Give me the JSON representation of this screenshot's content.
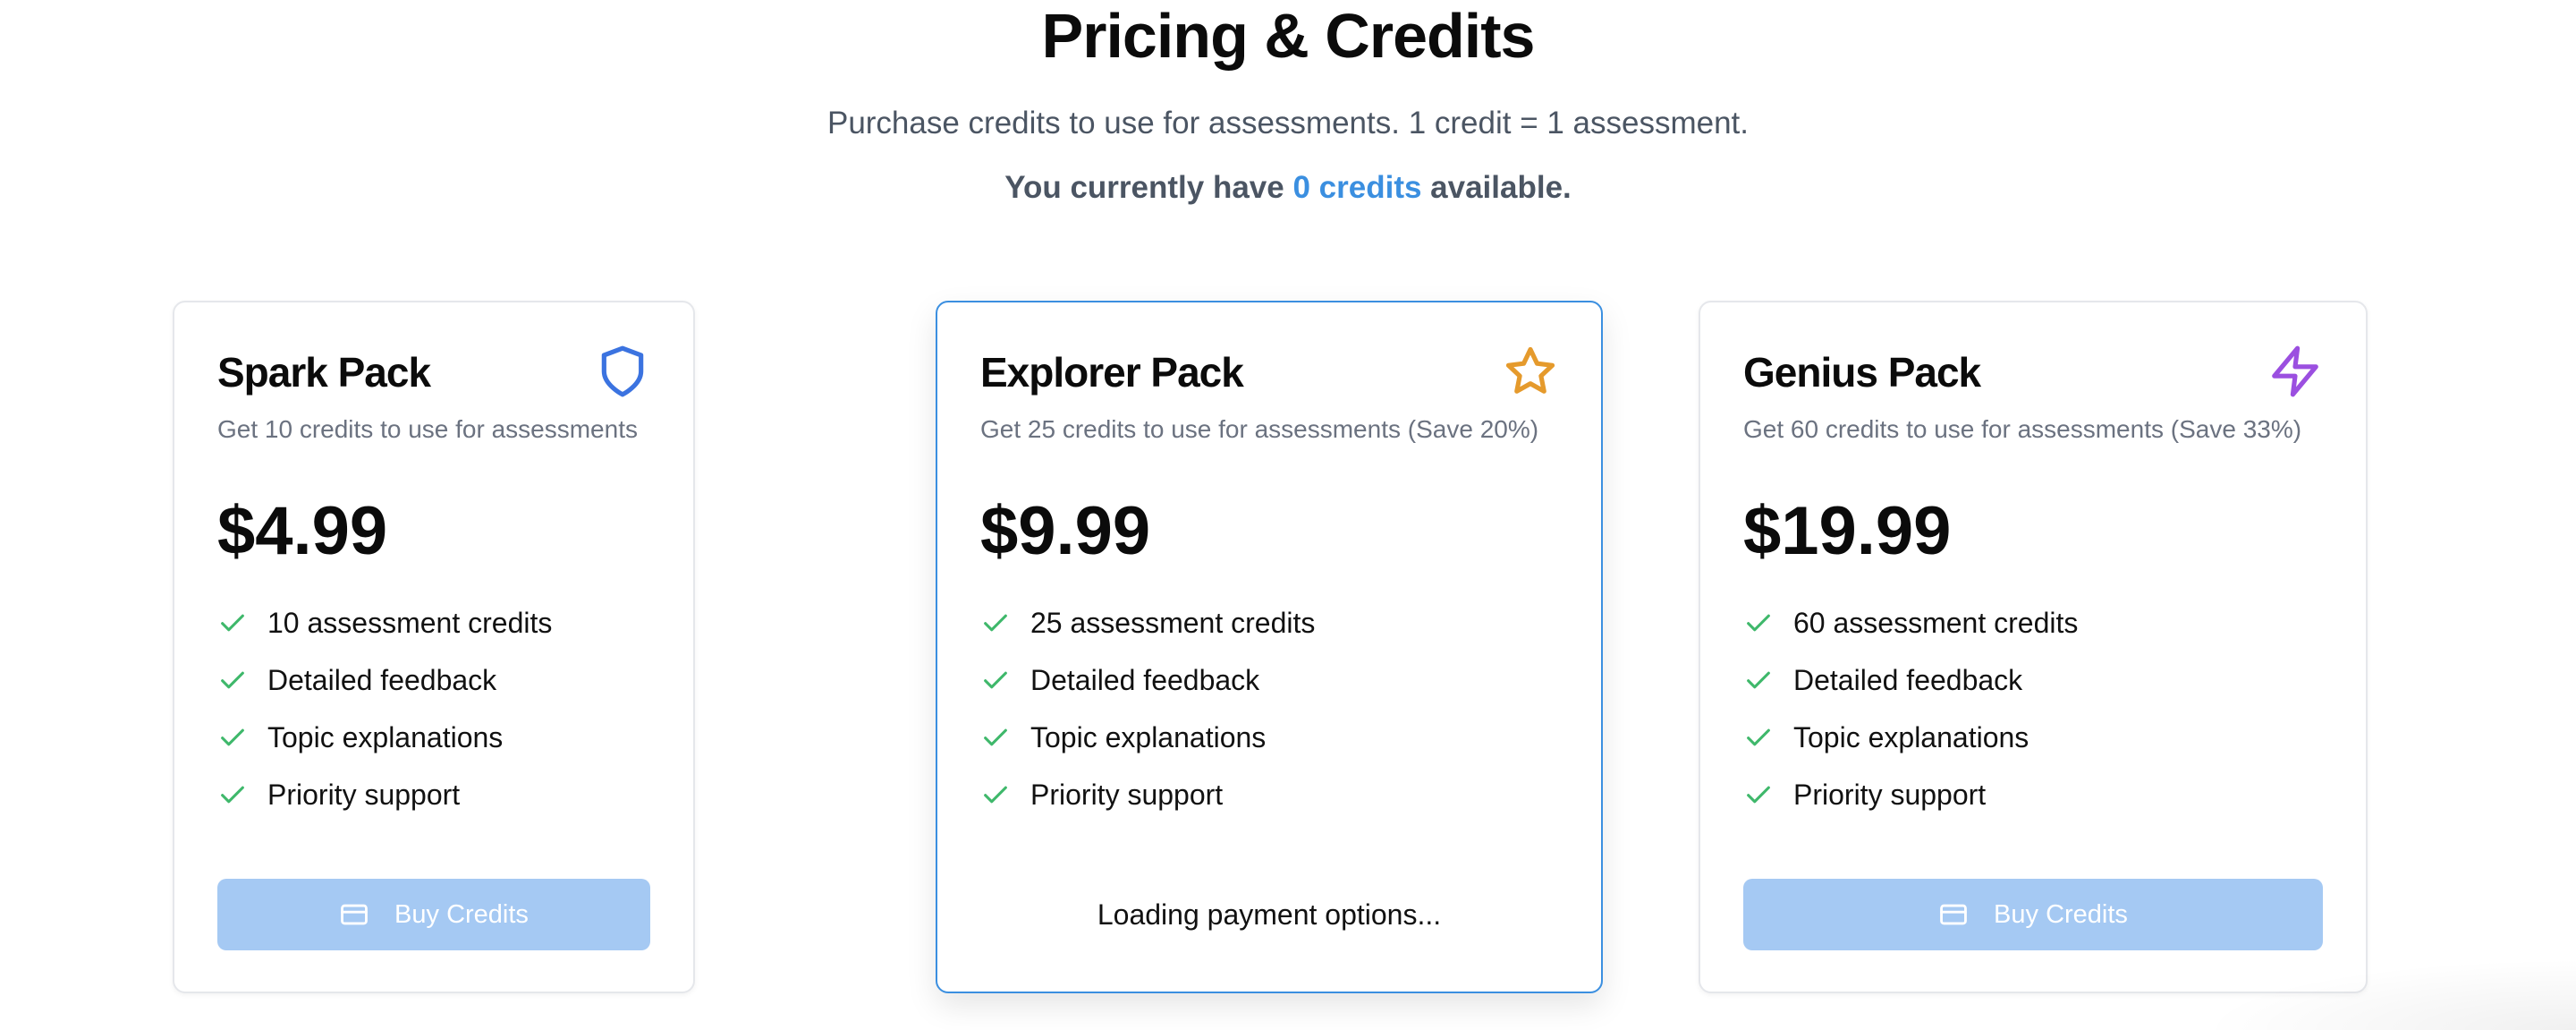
{
  "header": {
    "title": "Pricing & Credits",
    "subtitle": "Purchase credits to use for assessments. 1 credit = 1 assessment.",
    "credits_prefix": "You currently have ",
    "credits_value": "0 credits",
    "credits_suffix": " available.",
    "accent_color": "#3b8fe0"
  },
  "plans": [
    {
      "name": "Spark Pack",
      "icon": "shield-icon",
      "icon_color": "#3b73e0",
      "description": "Get 10 credits to use for assessments",
      "price": "$4.99",
      "features": [
        "10 assessment credits",
        "Detailed feedback",
        "Topic explanations",
        "Priority support"
      ],
      "button_label": "Buy Credits",
      "button_state": "disabled"
    },
    {
      "name": "Explorer Pack",
      "icon": "star-icon",
      "icon_color": "#e59a2c",
      "description": "Get 25 credits to use for assessments (Save 20%)",
      "price": "$9.99",
      "features": [
        "25 assessment credits",
        "Detailed feedback",
        "Topic explanations",
        "Priority support"
      ],
      "loading_text": "Loading payment options...",
      "featured": true
    },
    {
      "name": "Genius Pack",
      "icon": "lightning-icon",
      "icon_color": "#9b4fe0",
      "description": "Get 60 credits to use for assessments (Save 33%)",
      "price": "$19.99",
      "features": [
        "60 assessment credits",
        "Detailed feedback",
        "Topic explanations",
        "Priority support"
      ],
      "button_label": "Buy Credits",
      "button_state": "disabled"
    }
  ],
  "colors": {
    "check": "#3fb86b",
    "button_disabled_bg": "#a5c9f3",
    "featured_border": "#3b8fe0"
  }
}
